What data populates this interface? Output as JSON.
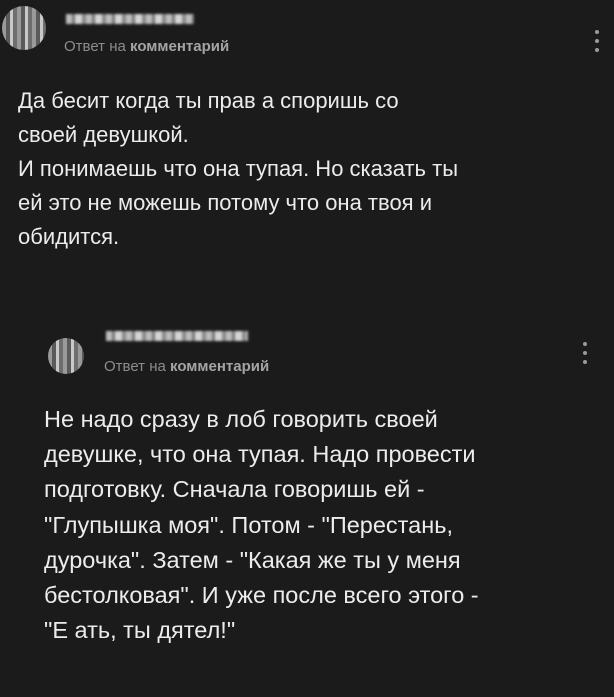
{
  "comments": [
    {
      "reply_prefix": "Ответ на",
      "reply_target": "комментарий",
      "text": "Да бесит когда ты прав а споришь со\nсвоей девушкой.\nИ понимаешь что она тупая. Но сказать ты\nей это не можешь потому что она твоя и\nобидится."
    },
    {
      "reply_prefix": "Ответ на",
      "reply_target": "комментарий",
      "text": "Не надо сразу в лоб говорить своей\nдевушке, что она тупая. Надо провести\nподготовку. Сначала говоришь ей -\n\"Глупышка моя\". Потом - \"Перестань,\nдурочка\". Затем - \"Какая же ты у меня\nбестолковая\". И уже после всего этого -\n\"Е  ать, ты дятел!\""
    }
  ],
  "icons": {
    "more": "vertical-ellipsis-icon"
  },
  "colors": {
    "background": "#1b1b1b",
    "text": "#ececec",
    "meta": "#8c8c8c"
  }
}
